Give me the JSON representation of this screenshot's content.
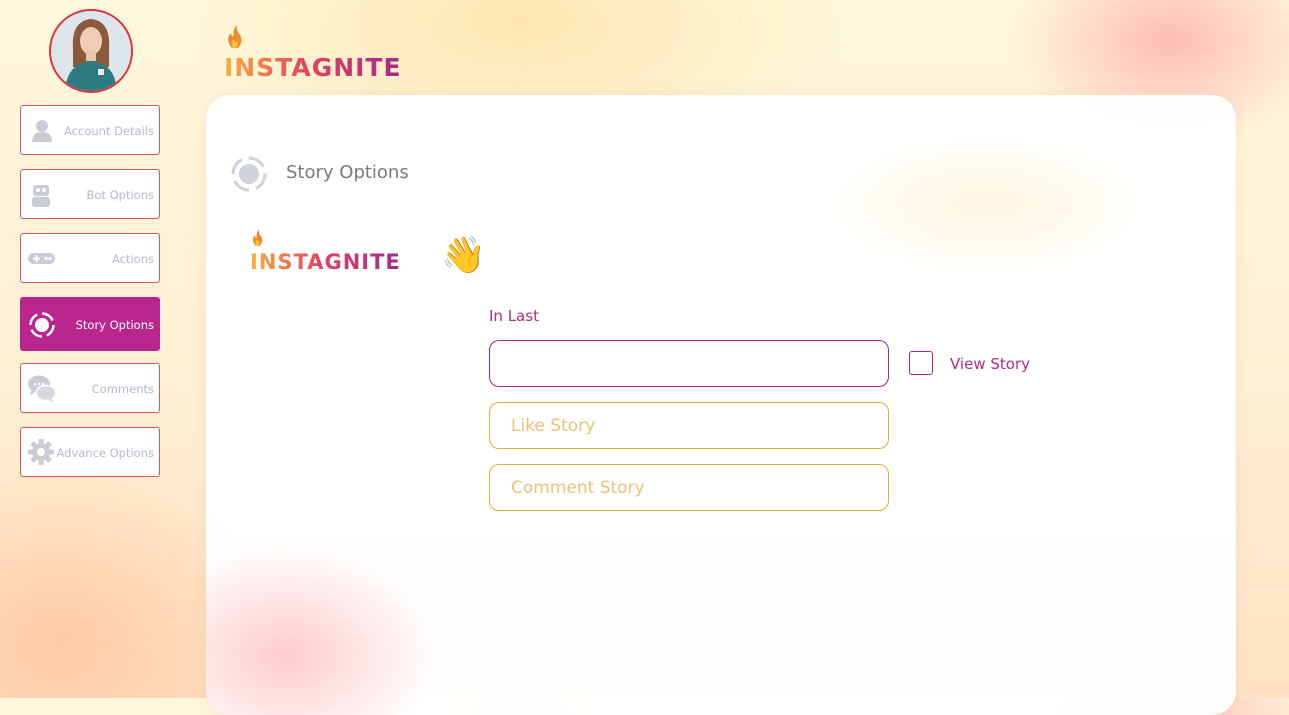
{
  "app": {
    "logo_text": "INSTAGNITE"
  },
  "sidebar": {
    "items": [
      {
        "label": "Account Details",
        "icon": "user-icon"
      },
      {
        "label": "Bot Options",
        "icon": "robot-icon"
      },
      {
        "label": "Actions",
        "icon": "gamepad-icon"
      },
      {
        "label": "Story Options",
        "icon": "story-icon",
        "active": true
      },
      {
        "label": "Comments",
        "icon": "comments-icon"
      },
      {
        "label": "Advance Options",
        "icon": "gear-icon"
      }
    ]
  },
  "main": {
    "section_title": "Story Options",
    "logo_text": "INSTAGNITE",
    "wave_emoji": "👋",
    "form": {
      "in_last_label": "In Last",
      "in_last_value": "",
      "view_story_label": "View Story",
      "view_story_checked": false,
      "like_story_placeholder": "Like Story",
      "comment_story_placeholder": "Comment Story"
    }
  },
  "colors": {
    "accent": "#b9268e",
    "nav_border": "#e0555c",
    "input_gold": "#e0b03a",
    "placeholder_gold": "#ecc078",
    "logo_gradient": [
      "#f6b13c",
      "#e8435f",
      "#a02a91"
    ]
  }
}
